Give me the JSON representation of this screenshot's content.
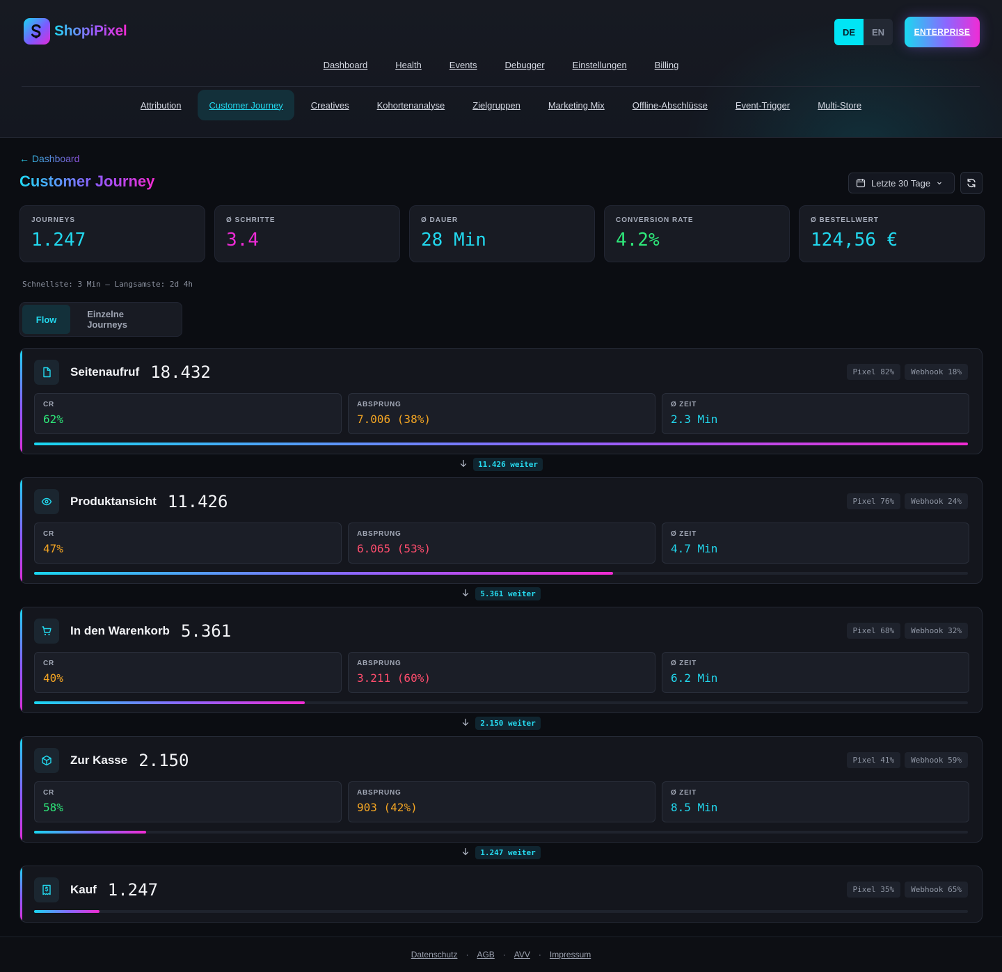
{
  "brand": {
    "name": "ShopiPixel"
  },
  "lang": {
    "de": "DE",
    "en": "EN"
  },
  "enterprise_label": "ENTERPRISE",
  "nav_primary": [
    "Dashboard",
    "Health",
    "Events",
    "Debugger",
    "Einstellungen",
    "Billing"
  ],
  "nav_secondary": [
    "Attribution",
    "Customer Journey",
    "Creatives",
    "Kohortenanalyse",
    "Zielgruppen",
    "Marketing Mix",
    "Offline-Abschlüsse",
    "Event-Trigger",
    "Multi-Store"
  ],
  "nav_secondary_active": "Customer Journey",
  "back_link": "← Dashboard",
  "page_title": "Customer Journey",
  "date_range": "Letzte 30 Tage",
  "kpis": [
    {
      "label": "JOURNEYS",
      "value": "1.247",
      "color": "#22d8ee"
    },
    {
      "label": "Ø SCHRITTE",
      "value": "3.4",
      "color": "#ee2bd6"
    },
    {
      "label": "Ø DAUER",
      "value": "28 Min",
      "color": "#22d8ee"
    },
    {
      "label": "CONVERSION RATE",
      "value": "4.2%",
      "color": "#2ee87a"
    },
    {
      "label": "Ø BESTELLWERT",
      "value": "124,56 €",
      "color": "#22d8ee"
    }
  ],
  "speed_note": "Schnellste: 3 Min — Langsamste: 2d 4h",
  "view_tabs": [
    "Flow",
    "Einzelne Journeys"
  ],
  "metric_labels": {
    "cr": "CR",
    "drop": "ABSPRUNG",
    "time": "Ø ZEIT"
  },
  "stages": [
    {
      "name": "Seitenaufruf",
      "count": "18.432",
      "icon": "file-icon",
      "pixel": "Pixel 82%",
      "webhook": "Webhook 18%",
      "cr": "62%",
      "cr_color": "#2ee87a",
      "drop": "7.006 (38%)",
      "drop_color": "#f5a623",
      "time": "2.3 Min",
      "share": 1.0,
      "next": "11.426 weiter"
    },
    {
      "name": "Produktansicht",
      "count": "11.426",
      "icon": "eye-icon",
      "pixel": "Pixel 76%",
      "webhook": "Webhook 24%",
      "cr": "47%",
      "cr_color": "#f5a623",
      "drop": "6.065 (53%)",
      "drop_color": "#ff4d6d",
      "time": "4.7 Min",
      "share": 0.62,
      "next": "5.361 weiter"
    },
    {
      "name": "In den Warenkorb",
      "count": "5.361",
      "icon": "cart-icon",
      "pixel": "Pixel 68%",
      "webhook": "Webhook 32%",
      "cr": "40%",
      "cr_color": "#f5a623",
      "drop": "3.211 (60%)",
      "drop_color": "#ff4d6d",
      "time": "6.2 Min",
      "share": 0.29,
      "next": "2.150 weiter"
    },
    {
      "name": "Zur Kasse",
      "count": "2.150",
      "icon": "box-icon",
      "pixel": "Pixel 41%",
      "webhook": "Webhook 59%",
      "cr": "58%",
      "cr_color": "#2ee87a",
      "drop": "903 (42%)",
      "drop_color": "#f5a623",
      "time": "8.5 Min",
      "share": 0.12,
      "next": "1.247 weiter"
    },
    {
      "name": "Kauf",
      "count": "1.247",
      "icon": "receipt-icon",
      "pixel": "Pixel 35%",
      "webhook": "Webhook 65%",
      "share": 0.07
    }
  ],
  "footer_links": [
    "Datenschutz",
    "AGB",
    "AVV",
    "Impressum"
  ],
  "footer_sep": "·"
}
